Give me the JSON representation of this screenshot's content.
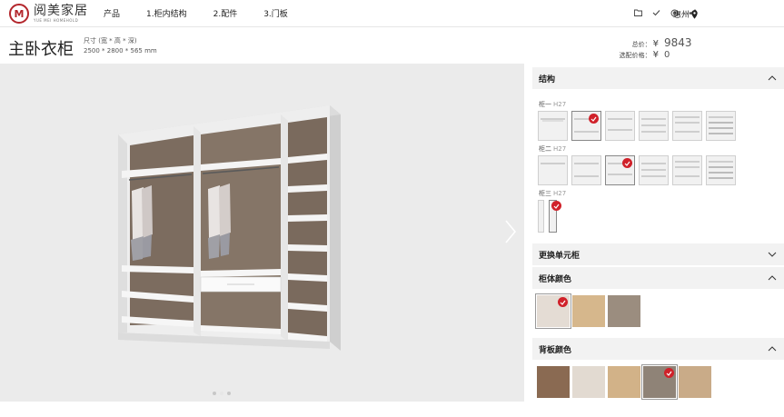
{
  "brand": {
    "name_cn": "阅美家居",
    "name_en": "YUE MEI HOMEHOLD"
  },
  "nav": [
    "产品",
    "1.柜内结构",
    "2.配件",
    "3.门板"
  ],
  "toolbar_icons": [
    "folder-icon",
    "check-icon",
    "settings-icon",
    "share-icon"
  ],
  "city": "惠州",
  "product": {
    "title": "主卧衣柜",
    "dims_label": "尺寸 (宽 * 高 * 深)",
    "dims_value": "2500 * 2800 * 565 mm"
  },
  "price": {
    "total_label": "总价：",
    "total_currency": "¥",
    "total_value": "9843",
    "option_label": "选配价格：",
    "option_currency": "¥",
    "option_value": "0"
  },
  "preview": {
    "slides": 3,
    "active_slide": 1
  },
  "panel": {
    "structure": {
      "title": "结构",
      "rows": [
        {
          "label": "柜一",
          "height": "H27",
          "selected": 1
        },
        {
          "label": "柜二",
          "height": "H27",
          "selected": 2
        },
        {
          "label": "柜三",
          "height": "H27",
          "selected": 0
        }
      ]
    },
    "replace_unit": {
      "title": "更换单元柜"
    },
    "body_color": {
      "title": "柜体颜色",
      "swatches": [
        "#e4dcd4",
        "#d6b78c",
        "#9b8d7f"
      ],
      "selected": 0
    },
    "back_color": {
      "title": "背板颜色",
      "swatches": [
        "#8a6a52",
        "#e2dad1",
        "#d2b288",
        "#8f8377",
        "#c9ab88"
      ],
      "selected": 3
    }
  }
}
